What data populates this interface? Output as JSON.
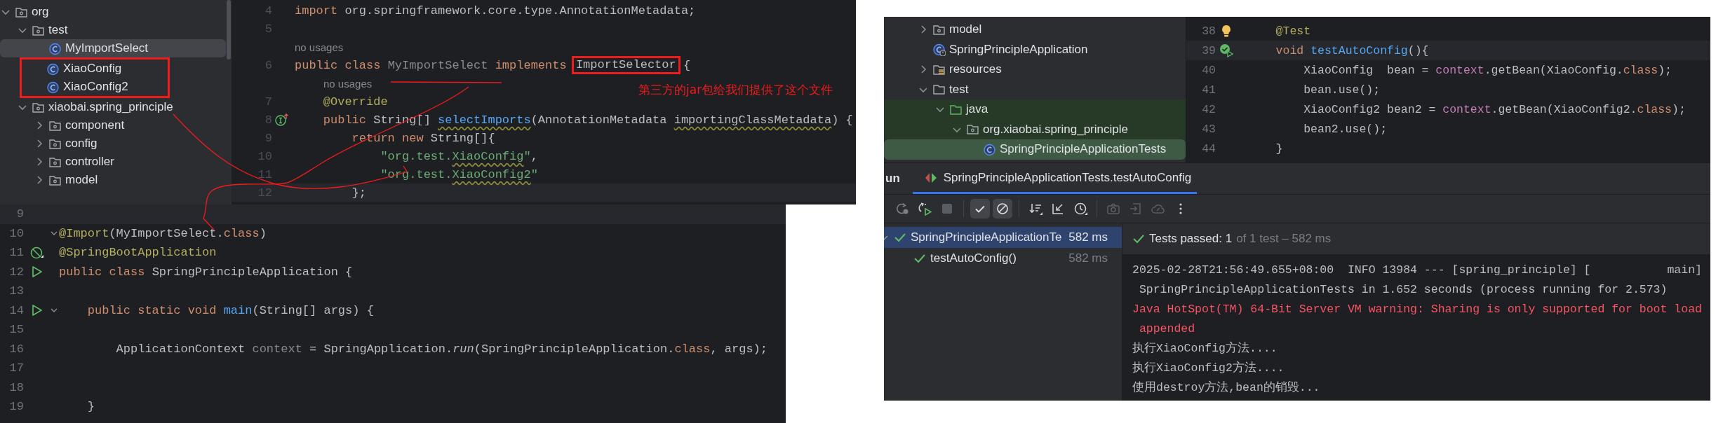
{
  "import_selector_window": {
    "project_tree": [
      {
        "label": "org",
        "kind": "package",
        "expanded": true,
        "selected": false,
        "children": [
          {
            "label": "test",
            "kind": "package",
            "expanded": true,
            "selected": false,
            "children": [
              {
                "label": "MyImportSelect",
                "kind": "class",
                "selected": true,
                "boxed": false
              },
              {
                "label": "XiaoConfig",
                "kind": "class",
                "selected": false,
                "boxed": true
              },
              {
                "label": "XiaoConfig2",
                "kind": "class",
                "selected": false,
                "boxed": true
              }
            ]
          },
          {
            "label": "xiaobai.spring_principle",
            "kind": "package",
            "expanded": true,
            "selected": false,
            "children": [
              {
                "label": "component",
                "kind": "package",
                "expanded": false,
                "selected": false
              },
              {
                "label": "config",
                "kind": "package",
                "expanded": false,
                "selected": false
              },
              {
                "label": "controller",
                "kind": "package",
                "expanded": false,
                "selected": false
              },
              {
                "label": "model",
                "kind": "package",
                "expanded": false,
                "selected": false
              }
            ]
          }
        ]
      }
    ],
    "editor": {
      "note": "第三方的jar包给我们提供了这个文件",
      "lines": [
        {
          "number": "4",
          "current": false,
          "tokens": [
            {
              "text": "import ",
              "kind": "keyword"
            },
            {
              "text": "org.springframework.core.type.AnnotationMetadata;",
              "kind": "plain"
            }
          ]
        },
        {
          "number": "5",
          "current": false
        },
        {
          "current": false,
          "tokens": [
            {
              "text": "no usages",
              "kind": "hint"
            }
          ]
        },
        {
          "number": "6",
          "current": false,
          "tokens": [
            {
              "text": "public class ",
              "kind": "keyword"
            },
            {
              "text": "MyImportSelect",
              "kind": "unused"
            },
            {
              "text": " implements ",
              "kind": "keyword"
            },
            {
              "text": "ImportSelector",
              "kind": "plain-boxed"
            },
            {
              "text": " {",
              "kind": "plain"
            }
          ]
        },
        {
          "current": false,
          "tokens": [
            {
              "text": "no usages",
              "kind": "indented-hint"
            }
          ]
        },
        {
          "number": "7",
          "current": false,
          "tokens": [
            {
              "text": "    @Override",
              "kind": "annotation"
            }
          ]
        },
        {
          "number": "8",
          "current": false,
          "kind": "override",
          "tokens": [
            {
              "text": "    public ",
              "kind": "keyword"
            },
            {
              "text": "String[] ",
              "kind": "plain"
            },
            {
              "text": "selectImports",
              "kind": "method-squiggle"
            },
            {
              "text": "(AnnotationMetadata ",
              "kind": "plain"
            },
            {
              "text": "importingClassMetadata",
              "kind": "plain-squiggle"
            },
            {
              "text": ") {",
              "kind": "plain"
            }
          ]
        },
        {
          "number": "9",
          "current": false,
          "tokens": [
            {
              "text": "        return new ",
              "kind": "keyword"
            },
            {
              "text": "String[]{",
              "kind": "plain"
            }
          ]
        },
        {
          "number": "10",
          "current": false,
          "tokens": [
            {
              "text": "            \"org.test.",
              "kind": "string"
            },
            {
              "text": "XiaoConfig",
              "kind": "string-squiggle"
            },
            {
              "text": "\"",
              "kind": "string"
            },
            {
              "text": ",",
              "kind": "plain"
            }
          ]
        },
        {
          "number": "11",
          "current": false,
          "tokens": [
            {
              "text": "            \"org.test.",
              "kind": "string"
            },
            {
              "text": "XiaoConfig2",
              "kind": "string-squiggle"
            },
            {
              "text": "\"",
              "kind": "string"
            }
          ]
        },
        {
          "number": "12",
          "current": true,
          "tokens": [
            {
              "text": "        };",
              "kind": "plain"
            }
          ]
        }
      ]
    }
  },
  "application_window": {
    "editor": {
      "lines": [
        {
          "number": "9",
          "current": true,
          "fold": false
        },
        {
          "number": "10",
          "current": false,
          "fold": true,
          "tokens": [
            {
              "text": "@Import",
              "kind": "annotation"
            },
            {
              "text": "(MyImportSelect.",
              "kind": "plain"
            },
            {
              "text": "class",
              "kind": "keyword"
            },
            {
              "text": ")",
              "kind": "plain"
            }
          ]
        },
        {
          "number": "11",
          "current": false,
          "fold": false,
          "kind": "spring-bean",
          "tokens": [
            {
              "text": "@SpringBootApplication",
              "kind": "annotation"
            }
          ]
        },
        {
          "number": "12",
          "current": false,
          "fold": false,
          "kind": "run",
          "tokens": [
            {
              "text": "public class ",
              "kind": "keyword"
            },
            {
              "text": "SpringPrincipleApplication {",
              "kind": "plain"
            }
          ]
        },
        {
          "number": "13",
          "current": false,
          "fold": false
        },
        {
          "number": "14",
          "current": false,
          "fold": true,
          "kind": "run",
          "tokens": [
            {
              "text": "    public static void ",
              "kind": "keyword"
            },
            {
              "text": "main",
              "kind": "method"
            },
            {
              "text": "(String[] args) {",
              "kind": "plain"
            }
          ]
        },
        {
          "number": "15",
          "current": false,
          "fold": false
        },
        {
          "number": "16",
          "current": false,
          "fold": false,
          "tokens": [
            {
              "text": "        ApplicationContext ",
              "kind": "plain"
            },
            {
              "text": "context",
              "kind": "unused"
            },
            {
              "text": " = SpringApplication.",
              "kind": "plain"
            },
            {
              "text": "run",
              "kind": "italic-method"
            },
            {
              "text": "(SpringPrincipleApplication.",
              "kind": "plain"
            },
            {
              "text": "class",
              "kind": "keyword"
            },
            {
              "text": ", args);",
              "kind": "plain"
            }
          ]
        },
        {
          "number": "17",
          "current": false,
          "fold": false
        },
        {
          "number": "18",
          "current": false,
          "fold": false
        },
        {
          "number": "19",
          "current": false,
          "fold": false,
          "tokens": [
            {
              "text": "    }",
              "kind": "plain"
            }
          ]
        }
      ]
    }
  },
  "test_window": {
    "project_tree": [
      {
        "label": "model",
        "kind": "package",
        "expanded": false,
        "selected": false,
        "highlighted": false
      },
      {
        "label": "SpringPrincipleApplication",
        "kind": "spring-class",
        "selected": false,
        "highlighted": false
      },
      {
        "label": "resources",
        "kind": "resources",
        "expanded": false,
        "selected": false,
        "highlighted": false
      },
      {
        "label": "test",
        "kind": "folder",
        "expanded": true,
        "selected": false,
        "highlighted": false,
        "children": [
          {
            "label": "java",
            "kind": "source-folder",
            "expanded": true,
            "selected": false,
            "highlighted": true,
            "children": [
              {
                "label": "org.xiaobai.spring_principle",
                "kind": "package",
                "expanded": true,
                "selected": false,
                "highlighted": true,
                "children": [
                  {
                    "label": "SpringPrincipleApplicationTests",
                    "kind": "class",
                    "selected": true,
                    "highlighted": true
                  }
                ]
              }
            ]
          }
        ]
      }
    ],
    "editor": {
      "lines": [
        {
          "number": "38",
          "current": false,
          "kind": "bulb",
          "tokens": [
            {
              "text": "    @Test",
              "kind": "annotation"
            }
          ]
        },
        {
          "number": "39",
          "current": true,
          "kind": "test-passed",
          "tokens": [
            {
              "text": "    void ",
              "kind": "keyword"
            },
            {
              "text": "testAutoConfig",
              "kind": "method"
            },
            {
              "text": "(){",
              "kind": "plain"
            }
          ]
        },
        {
          "number": "40",
          "current": false,
          "tokens": [
            {
              "text": "        XiaoConfig  bean = ",
              "kind": "plain"
            },
            {
              "text": "context",
              "kind": "field"
            },
            {
              "text": ".getBean(XiaoConfig.",
              "kind": "plain"
            },
            {
              "text": "class",
              "kind": "keyword"
            },
            {
              "text": ");",
              "kind": "plain"
            }
          ]
        },
        {
          "number": "41",
          "current": false,
          "tokens": [
            {
              "text": "        bean.use();",
              "kind": "plain"
            }
          ]
        },
        {
          "number": "42",
          "current": false,
          "tokens": [
            {
              "text": "        XiaoConfig2 bean2 = ",
              "kind": "plain"
            },
            {
              "text": "context",
              "kind": "field"
            },
            {
              "text": ".getBean(XiaoConfig2.",
              "kind": "plain"
            },
            {
              "text": "class",
              "kind": "keyword"
            },
            {
              "text": ");",
              "kind": "plain"
            }
          ]
        },
        {
          "number": "43",
          "current": false,
          "tokens": [
            {
              "text": "        bean2.use();",
              "kind": "plain"
            }
          ]
        },
        {
          "number": "44",
          "current": false,
          "tokens": [
            {
              "text": "    }",
              "kind": "plain"
            }
          ]
        }
      ]
    },
    "run_panel": {
      "tool_window": "un",
      "tabs": [
        {
          "label": "SpringPrincipleApplicationTests.testAutoConfig",
          "selected": true
        }
      ],
      "toolbar": [
        {
          "kind": "button",
          "toggled": false,
          "disabled": false
        },
        {
          "kind": "button",
          "toggled": false,
          "disabled": false
        },
        {
          "kind": "button",
          "toggled": false,
          "disabled": true
        },
        {
          "kind": "separator"
        },
        {
          "kind": "button",
          "toggled": true,
          "disabled": false
        },
        {
          "kind": "button",
          "toggled": true,
          "disabled": false
        },
        {
          "kind": "separator"
        },
        {
          "kind": "button",
          "toggled": false,
          "disabled": false
        },
        {
          "kind": "button",
          "toggled": false,
          "disabled": false
        },
        {
          "kind": "button",
          "toggled": false,
          "disabled": false
        },
        {
          "kind": "separator"
        },
        {
          "kind": "button",
          "toggled": false,
          "disabled": true
        },
        {
          "kind": "button",
          "toggled": false,
          "disabled": true
        },
        {
          "kind": "button",
          "toggled": false,
          "disabled": true
        },
        {
          "kind": "button",
          "toggled": false,
          "disabled": false
        }
      ],
      "test_tree": [
        {
          "label": "SpringPrincipleApplicationTe",
          "time": "582 ms",
          "passed": true,
          "selected": true,
          "expanded": true,
          "children": [
            {
              "label": "testAutoConfig()",
              "time": "582 ms",
              "passed": true,
              "selected": false
            }
          ]
        }
      ],
      "status": {
        "summary": "Tests passed: 1",
        "detail": "of 1 test – 582 ms"
      },
      "console": [
        {
          "text": "2025-02-28T21:56:49.655+08:00  INFO 13984 --- [spring_principle] [           main]",
          "kind": "info"
        },
        {
          "text": " SpringPrincipleApplicationTests in 1.652 seconds (process running for 2.573)",
          "kind": "info"
        },
        {
          "text": "Java HotSpot(TM) 64-Bit Server VM warning: Sharing is only supported for boot load",
          "kind": "error"
        },
        {
          "text": " appended",
          "kind": "error"
        },
        {
          "text": "执行XiaoConfig方法....",
          "kind": "info"
        },
        {
          "text": "执行XiaoConfig2方法....",
          "kind": "info"
        },
        {
          "text": "使用destroy方法,bean的销毁...",
          "kind": "info"
        }
      ]
    }
  }
}
